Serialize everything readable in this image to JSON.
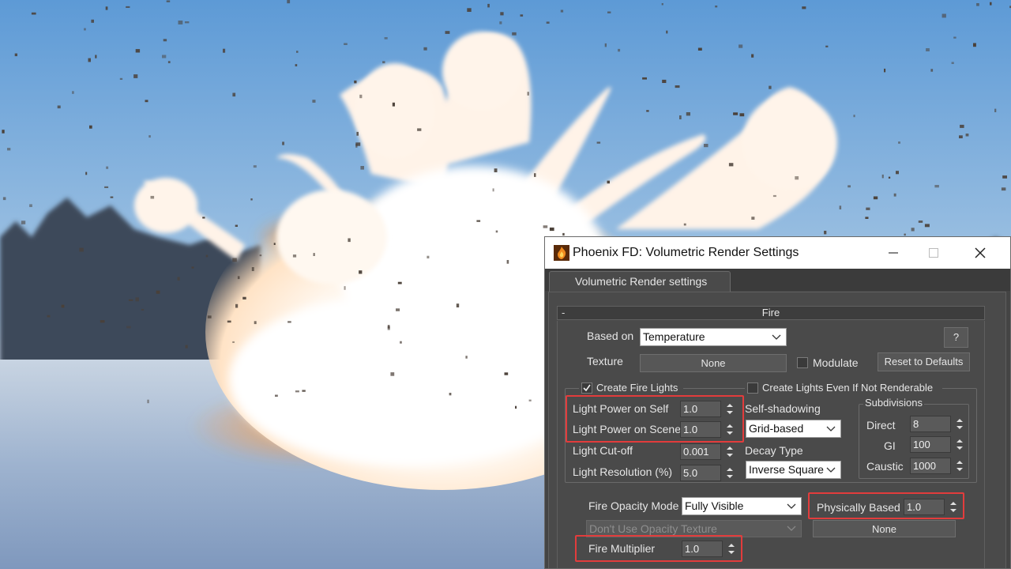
{
  "window": {
    "title": "Phoenix FD: Volumetric Render Settings",
    "icon": "phoenix-fire-icon",
    "controls": {
      "minimize": "minimize-icon",
      "maximize": "maximize-icon",
      "close": "close-icon"
    }
  },
  "tab": {
    "label": "Volumetric Render settings"
  },
  "rollout": {
    "title": "Fire",
    "collapse_symbol": "-",
    "based_on": {
      "label": "Based on",
      "value": "Temperature"
    },
    "help_label": "?",
    "texture": {
      "label": "Texture",
      "button": "None"
    },
    "modulate": {
      "label": "Modulate",
      "checked": false
    },
    "reset_label": "Reset to Defaults",
    "create_fire_lights": {
      "label": "Create Fire Lights",
      "checked": true
    },
    "create_lights_even": {
      "label": "Create Lights Even If Not Renderable",
      "checked": false
    },
    "light_power_self": {
      "label": "Light Power on Self",
      "value": "1.0"
    },
    "light_power_scene": {
      "label": "Light Power on Scene",
      "value": "1.0"
    },
    "light_cutoff": {
      "label": "Light Cut-off",
      "value": "0.001"
    },
    "light_resolution": {
      "label": "Light Resolution (%)",
      "value": "5.0"
    },
    "self_shadowing": {
      "label": "Self-shadowing",
      "value": "Grid-based"
    },
    "decay_type": {
      "label": "Decay Type",
      "value": "Inverse Square"
    },
    "subdivisions": {
      "label": "Subdivisions",
      "direct": {
        "label": "Direct",
        "value": "8"
      },
      "gi": {
        "label": "GI",
        "value": "100"
      },
      "caustic": {
        "label": "Caustic",
        "value": "1000"
      }
    },
    "fire_opacity_mode": {
      "label": "Fire Opacity Mode",
      "value": "Fully Visible"
    },
    "physically_based": {
      "label": "Physically Based",
      "value": "1.0"
    },
    "opacity_texture": {
      "value": "Don't Use Opacity Texture",
      "button": "None"
    },
    "fire_multiplier": {
      "label": "Fire Multiplier",
      "value": "1.0"
    }
  },
  "colors": {
    "highlight": "#e23c3c",
    "panel": "#4a4a4a",
    "window_bg": "#444444"
  }
}
